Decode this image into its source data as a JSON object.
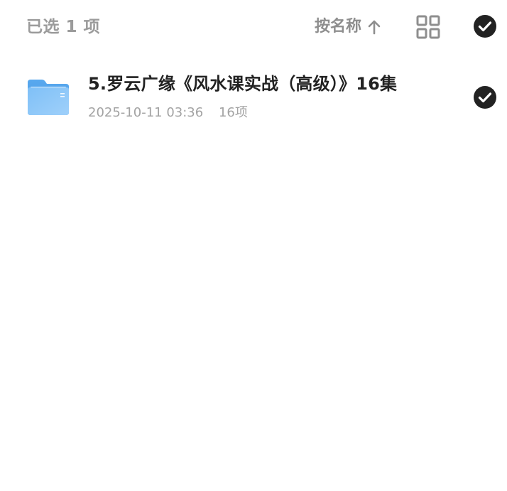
{
  "toolbar": {
    "selected_label": "已选 1 项",
    "sort_label": "按名称",
    "sort_icon": "arrow-up-icon",
    "view_icon": "grid-view-icon",
    "select_all_icon": "check-circle-icon"
  },
  "files": [
    {
      "name": "5.罗云广缘《风水课实战（高级）》16集",
      "date": "2025-10-11 03:36",
      "count": "16项",
      "icon": "folder-icon",
      "selected": true
    }
  ],
  "colors": {
    "muted_text": "#9b9b9b",
    "title_text": "#222222",
    "meta_text": "#a3a3a3",
    "check_fill": "#222222",
    "folder_blue": "#6fb8f5"
  }
}
